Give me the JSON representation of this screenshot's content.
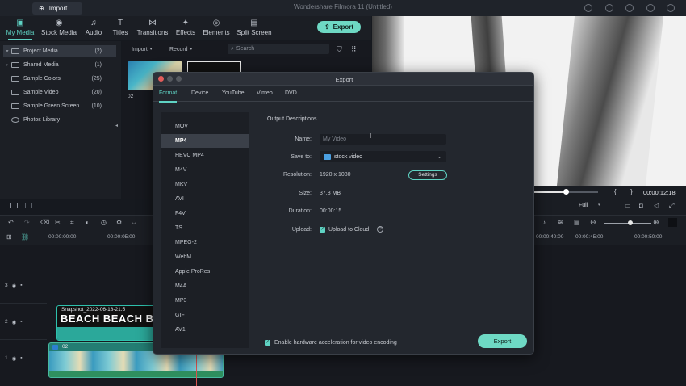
{
  "app": {
    "title": "Wondershare Filmora 11 (Untitled)",
    "import_label": "Import",
    "export_label": "Export"
  },
  "tabs": [
    {
      "label": "My Media",
      "icon": "media-icon",
      "active": true
    },
    {
      "label": "Stock Media",
      "icon": "stock-icon",
      "active": false
    },
    {
      "label": "Audio",
      "icon": "music-icon",
      "active": false
    },
    {
      "label": "Titles",
      "icon": "titles-icon",
      "active": false
    },
    {
      "label": "Transitions",
      "icon": "transitions-icon",
      "active": false
    },
    {
      "label": "Effects",
      "icon": "effects-icon",
      "active": false
    },
    {
      "label": "Elements",
      "icon": "elements-icon",
      "active": false
    },
    {
      "label": "Split Screen",
      "icon": "split-screen-icon",
      "active": false
    }
  ],
  "sidebar": {
    "items": [
      {
        "label": "Project Media",
        "count": "(2)",
        "selected": true,
        "arrow": "▾"
      },
      {
        "label": "Shared Media",
        "count": "(1)",
        "selected": false,
        "arrow": "›"
      },
      {
        "label": "Sample Colors",
        "count": "(25)",
        "selected": false,
        "arrow": ""
      },
      {
        "label": "Sample Video",
        "count": "(20)",
        "selected": false,
        "arrow": ""
      },
      {
        "label": "Sample Green Screen",
        "count": "(10)",
        "selected": false,
        "arrow": ""
      },
      {
        "label": "Photos Library",
        "count": "",
        "selected": false,
        "arrow": ""
      }
    ]
  },
  "media": {
    "import_dropdown": "Import",
    "record_dropdown": "Record",
    "search_placeholder": "Search",
    "thumb1_label": "02",
    "thumb2_text": "BEACH"
  },
  "preview": {
    "timecode": "00:00:12:18",
    "progress": 0.5,
    "quality": "Full"
  },
  "timeline": {
    "ruler": [
      "00:00:00:00",
      "00:00:05:00",
      "00:00:40:00",
      "00:00:45:00",
      "00:00:50:00"
    ],
    "tracks": [
      "3",
      "2",
      "1"
    ],
    "clip2_caption": "Snapshot_2022-06-18-21.5",
    "clip2_text": "BEACH BEACH B",
    "clip1_caption": "02"
  },
  "dialog": {
    "title": "Export",
    "tabs": [
      {
        "label": "Format",
        "active": true
      },
      {
        "label": "Device",
        "active": false
      },
      {
        "label": "YouTube",
        "active": false
      },
      {
        "label": "Vimeo",
        "active": false
      },
      {
        "label": "DVD",
        "active": false
      }
    ],
    "formats": [
      "MOV",
      "MP4",
      "HEVC MP4",
      "M4V",
      "MKV",
      "AVI",
      "F4V",
      "TS",
      "MPEG-2",
      "WebM",
      "Apple ProRes",
      "M4A",
      "MP3",
      "GIF",
      "AV1"
    ],
    "selected_format": "MP4",
    "section_title": "Output Descriptions",
    "name_label": "Name:",
    "name_placeholder": "My Video",
    "save_label": "Save to:",
    "save_value": "stock video",
    "resolution_label": "Resolution:",
    "resolution_value": "1920 x 1080",
    "settings_label": "Settings",
    "size_label": "Size:",
    "size_value": "37.8 MB",
    "duration_label": "Duration:",
    "duration_value": "00:00:15",
    "upload_label": "Upload:",
    "upload_value": "Upload to Cloud",
    "hw_accel_label": "Enable hardware acceleration for video encoding",
    "export_label": "Export"
  },
  "colors": {
    "accent": "#5fd3c4",
    "export_button": "#6ed9c4"
  }
}
